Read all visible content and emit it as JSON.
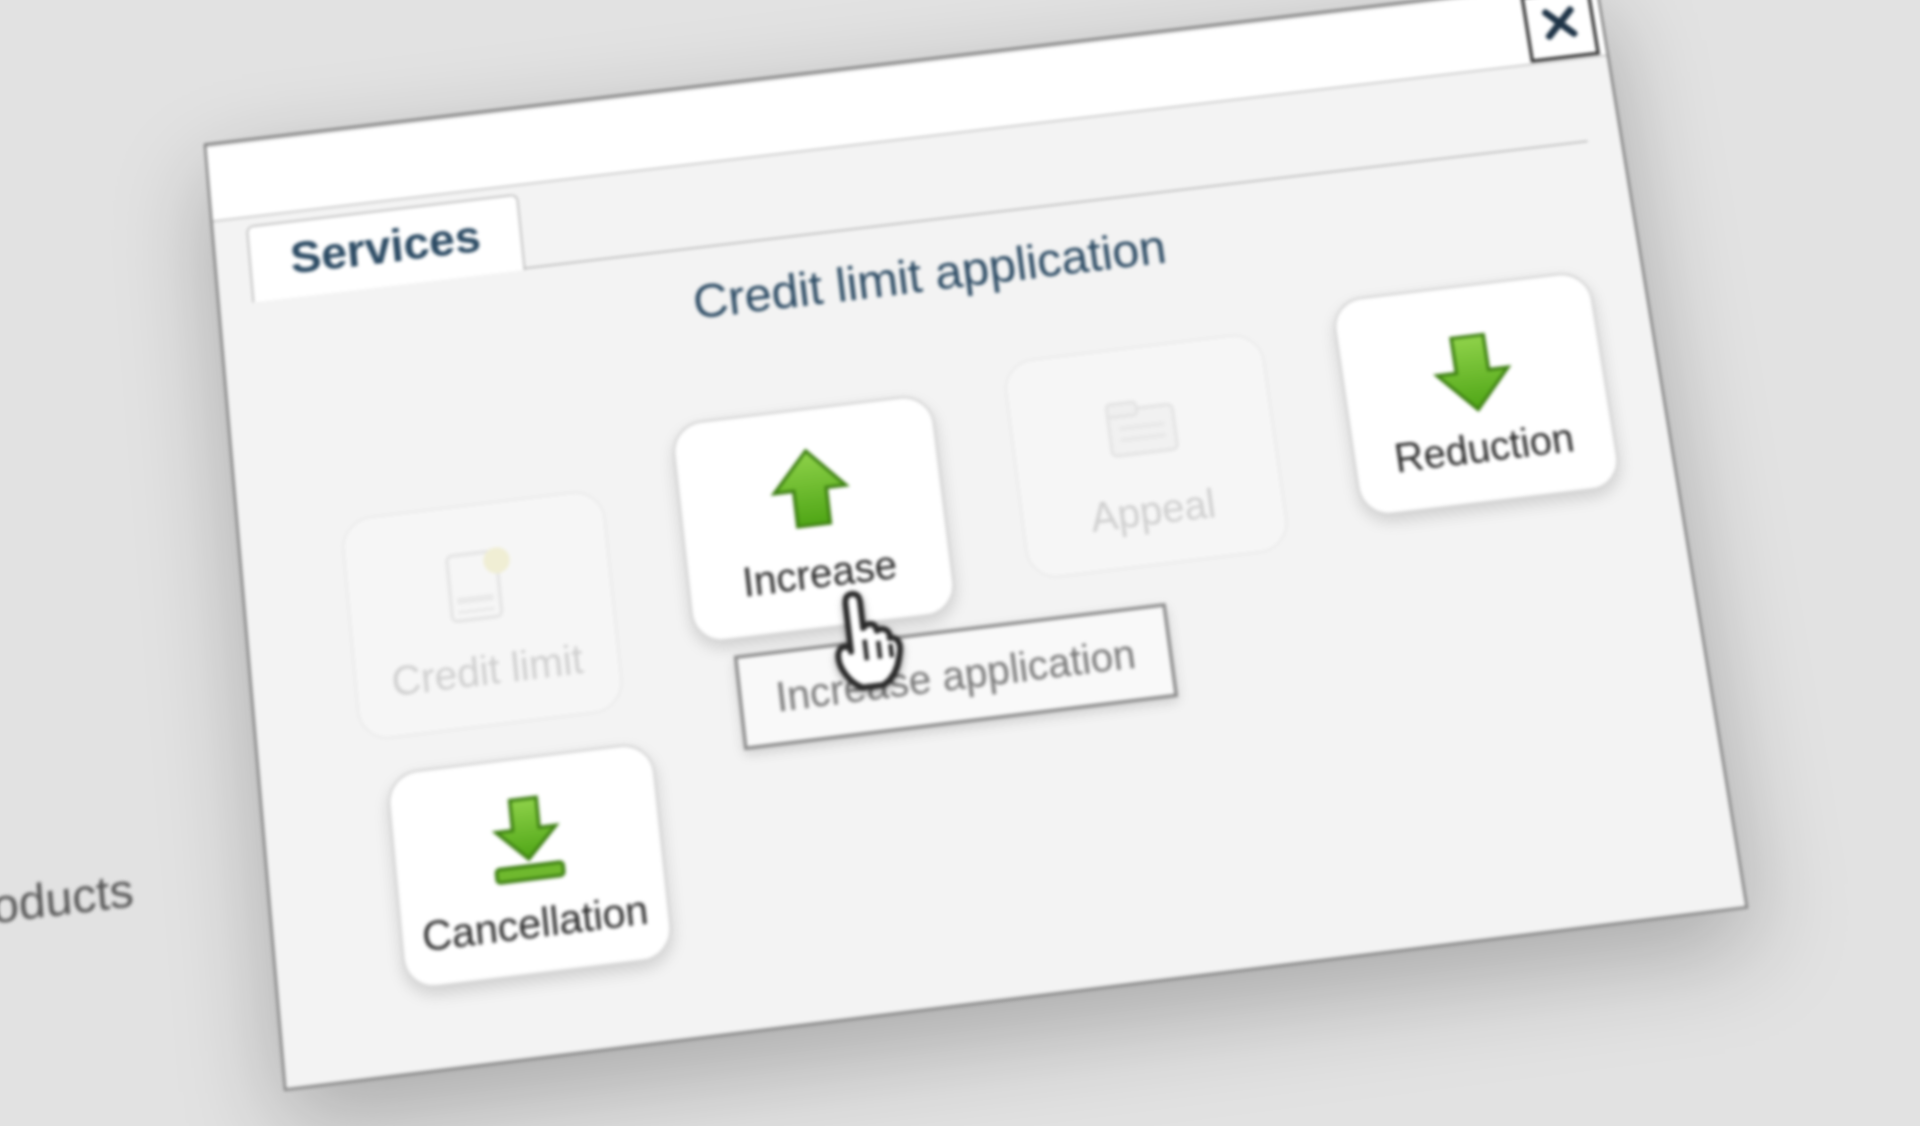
{
  "sidebar": {
    "fragment_label": "oducts"
  },
  "modal": {
    "tab_label": "Services",
    "section_title": "Credit limit application",
    "tooltip_text": "Increase application",
    "tiles": {
      "credit_limit": "Credit limit",
      "increase": "Increase",
      "appeal": "Appeal",
      "reduction": "Reduction",
      "cancellation": "Cancellation"
    }
  }
}
